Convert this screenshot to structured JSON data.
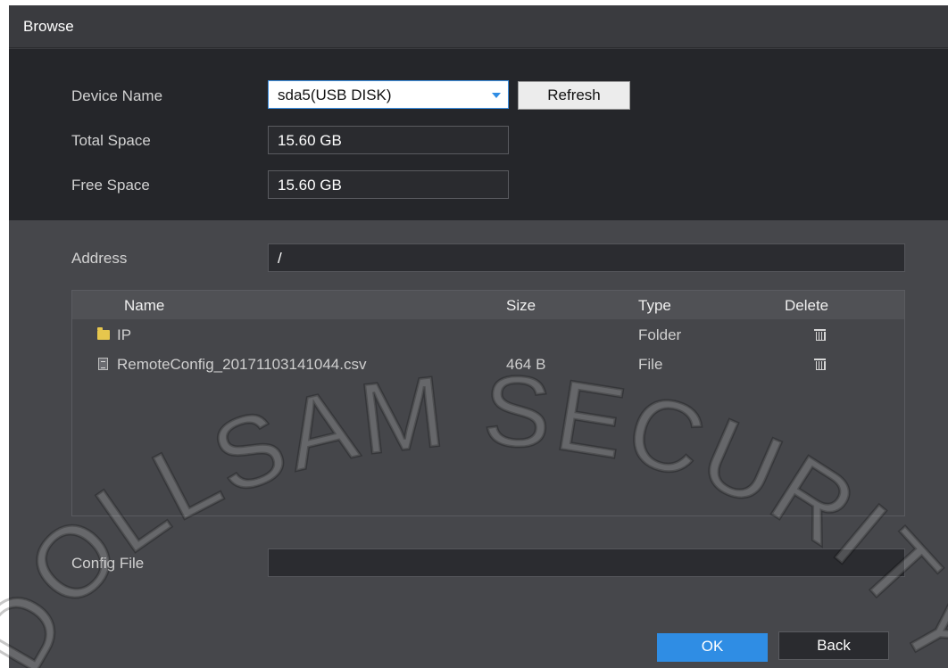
{
  "window": {
    "title": "Browse"
  },
  "device": {
    "name_label": "Device Name",
    "name_value": "sda5(USB DISK)",
    "refresh_label": "Refresh",
    "total_label": "Total Space",
    "total_value": "15.60 GB",
    "free_label": "Free Space",
    "free_value": "15.60 GB"
  },
  "address": {
    "label": "Address",
    "value": "/"
  },
  "table": {
    "columns": [
      "Name",
      "Size",
      "Type",
      "Delete"
    ],
    "rows": [
      {
        "icon": "folder-icon",
        "name": "IP",
        "size": "",
        "type": "Folder",
        "delete_icon": "trash-icon"
      },
      {
        "icon": "file-icon",
        "name": "RemoteConfig_20171103141044.csv",
        "size": "464 B",
        "type": "File",
        "delete_icon": "trash-icon"
      }
    ]
  },
  "config": {
    "label": "Config File",
    "value": ""
  },
  "actions": {
    "ok_label": "OK",
    "back_label": "Back"
  },
  "watermark": {
    "text": "DOLLSAM SECURITY"
  },
  "colors": {
    "accent": "#2f8de4",
    "folder": "#e6c64d"
  }
}
